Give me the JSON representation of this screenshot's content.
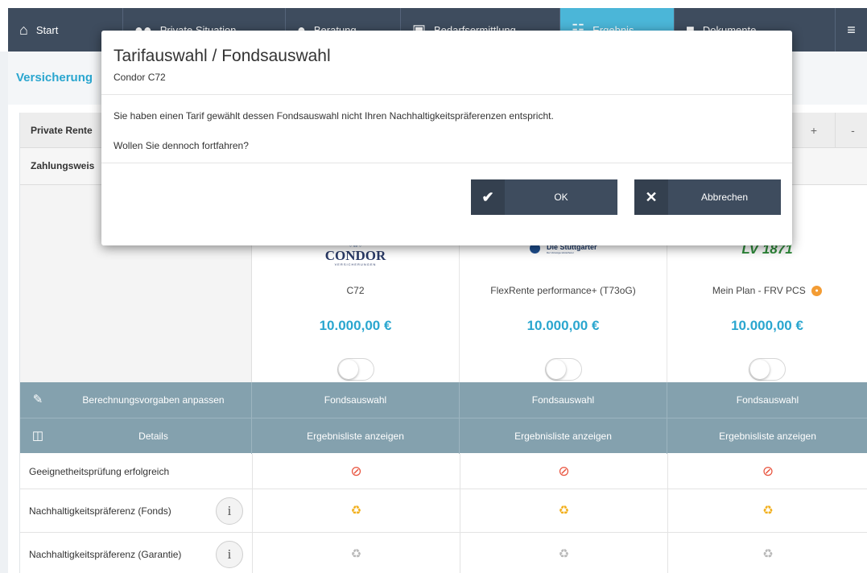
{
  "nav": {
    "items": [
      {
        "label": "Start",
        "icon": "home-icon"
      },
      {
        "label": "Private Situation",
        "icon": "people-icon"
      },
      {
        "label": "Beratung",
        "icon": "chat-icon"
      },
      {
        "label": "Bedarfsermittlung",
        "icon": "calculator-icon"
      },
      {
        "label": "Ergebnis",
        "icon": "clipboard-icon"
      },
      {
        "label": "Dokumente",
        "icon": "document-icon"
      }
    ],
    "menu_icon": "≡"
  },
  "subheader": {
    "title": "Versicherung"
  },
  "rows": {
    "private_rente": "Private Rente",
    "plus": "+",
    "minus": "-",
    "zahlungsweise": "Zahlungsweis"
  },
  "products": [
    {
      "logo": "CONDOR",
      "logo_sub": "VERSICHERUNGEN",
      "tarif": "C72",
      "price": "10.000,00 €"
    },
    {
      "logo": "Die Stuttgarter",
      "logo_sub": "Der Vorsorge-Versicherer",
      "tarif": "FlexRente performance+ (T73oG)",
      "price": "10.000,00 €"
    },
    {
      "logo": "LV 1871",
      "logo_sub": "",
      "tarif": "Mein Plan - FRV PCS",
      "price": "10.000,00 €"
    }
  ],
  "bars": {
    "calc_label": "Berechnungsvorgaben anpassen",
    "fonds_label": "Fondsauswahl",
    "details_label": "Details",
    "list_label": "Ergebnisliste anzeigen"
  },
  "table": {
    "rows": [
      {
        "label": "Geeignetheitsprüfung erfolgreich",
        "status": "not-fulfilled"
      },
      {
        "label": "Nachhaltigkeitspräferenz (Fonds)",
        "status": "partially-fulfilled"
      },
      {
        "label": "Nachhaltigkeitspräferenz (Garantie)",
        "status": "not-applicable"
      }
    ],
    "info_glyph": "i"
  },
  "modal": {
    "title": "Tarifauswahl / Fondsauswahl",
    "subtitle": "Condor C72",
    "message": "Sie haben einen Tarif gewählt dessen Fondsauswahl nicht Ihren Nachhaltigkeitspräferenzen entspricht.",
    "question": "Wollen Sie dennoch fortfahren?",
    "ok_label": "OK",
    "cancel_label": "Abbrechen"
  },
  "colors": {
    "nav_bg": "#3e4c5e",
    "nav_active": "#4bb6d8",
    "accent": "#2aa6cf",
    "bar_bg": "#84a1ae",
    "error": "#e8503a",
    "warning": "#f2b01e"
  }
}
